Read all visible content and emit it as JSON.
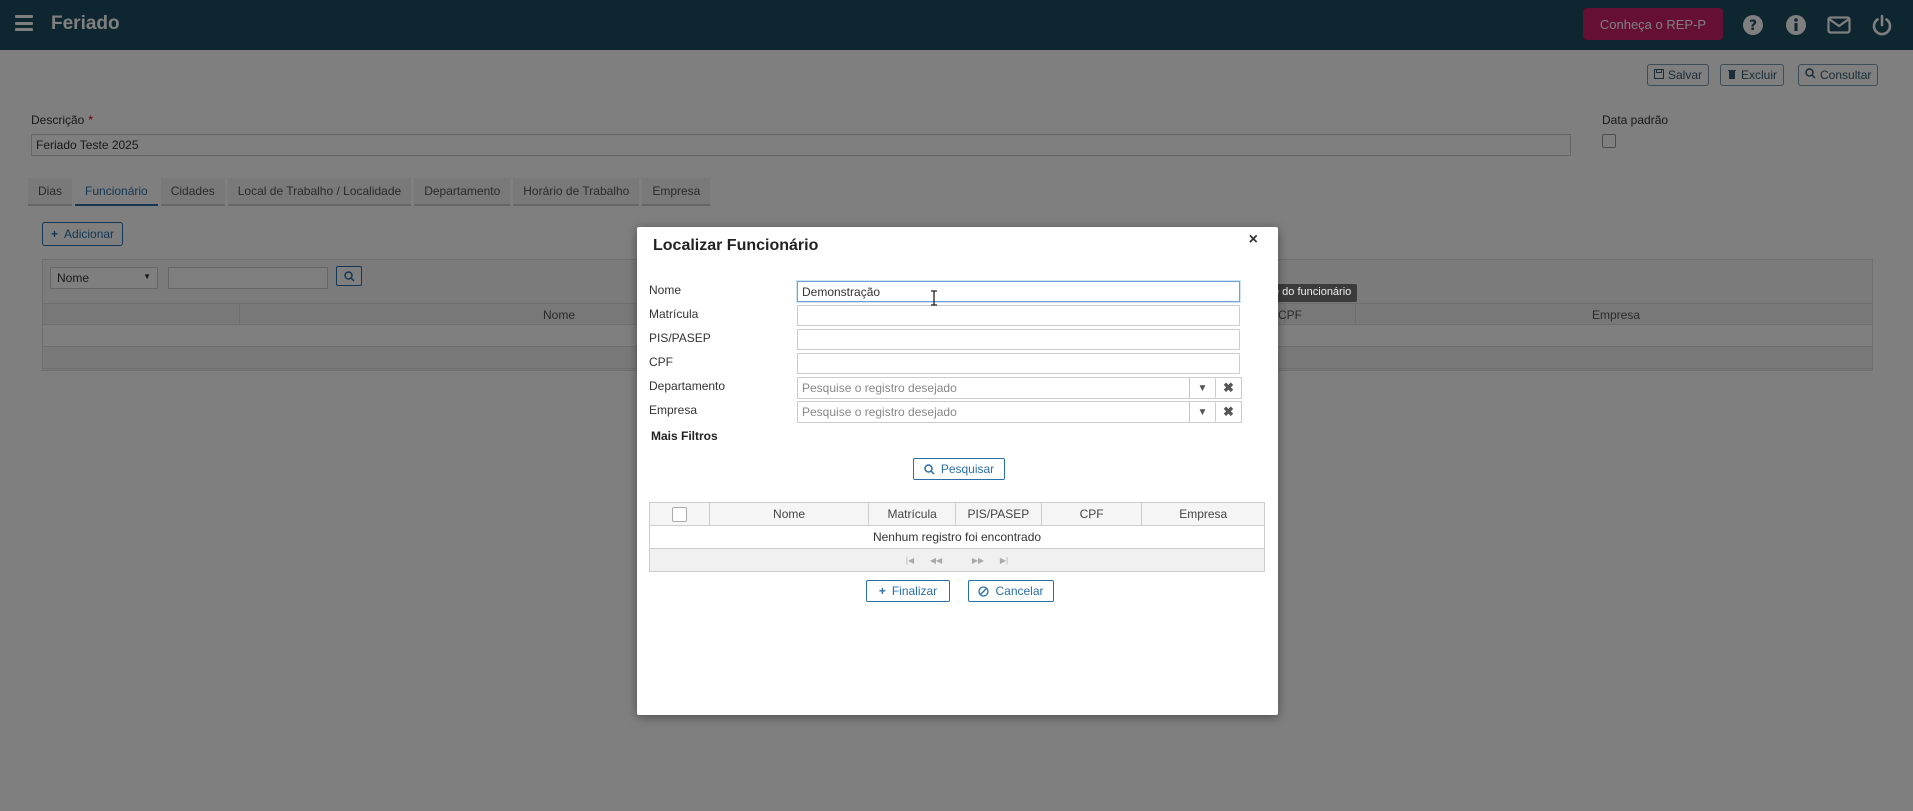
{
  "app": {
    "title": "Feriado",
    "promo_label": "Conheça o REP-P"
  },
  "toolbar": {
    "save": "Salvar",
    "delete": "Excluir",
    "consult": "Consultar"
  },
  "form": {
    "description_label": "Descrição",
    "required_mark": "*",
    "description_value": "Feriado Teste 2025",
    "default_date_label": "Data padrão"
  },
  "tabs": [
    "Dias",
    "Funcionário",
    "Cidades",
    "Local de Trabalho / Localidade",
    "Departamento",
    "Horário de Trabalho",
    "Empresa"
  ],
  "active_tab": "Funcionário",
  "employee_tab": {
    "add_label": "Adicionar",
    "filter_select": "Nome",
    "columns": {
      "nome": "Nome",
      "cpf": "CPF",
      "empresa": "Empresa"
    }
  },
  "tooltip": "e do funcionário",
  "modal": {
    "title": "Localizar Funcionário",
    "fields": {
      "nome_label": "Nome",
      "nome_value": "Demonstração",
      "matricula_label": "Matrícula",
      "pis_label": "PIS/PASEP",
      "cpf_label": "CPF",
      "departamento_label": "Departamento",
      "empresa_label": "Empresa",
      "lookup_placeholder": "Pesquise o registro desejado"
    },
    "more_filters": "Mais Filtros",
    "search_button": "Pesquisar",
    "table_columns": [
      "Nome",
      "Matrícula",
      "PIS/PASEP",
      "CPF",
      "Empresa"
    ],
    "empty_message": "Nenhum registro foi encontrado",
    "finish_button": "Finalizar",
    "cancel_button": "Cancelar"
  },
  "colors": {
    "topbar": "#1c4c5e",
    "promo": "#cc1f6b",
    "accent": "#2a6fa8"
  }
}
